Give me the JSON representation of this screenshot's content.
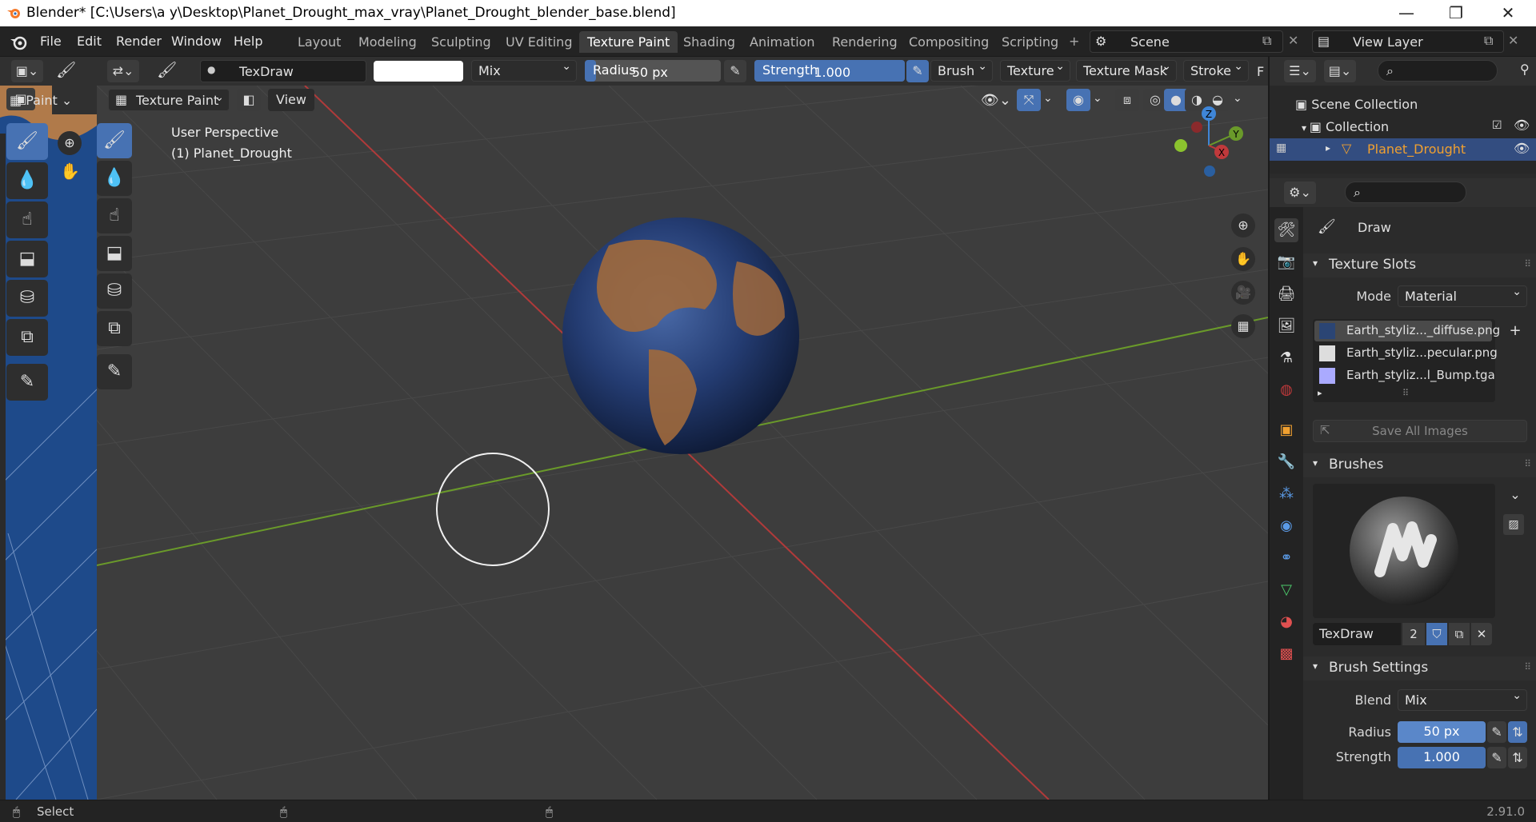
{
  "window": {
    "title": "Blender* [C:\\Users\\a y\\Desktop\\Planet_Drought_max_vray\\Planet_Drought_blender_base.blend]",
    "minimize": "—",
    "maximize": "❐",
    "close": "✕"
  },
  "menubar": {
    "items": [
      "File",
      "Edit",
      "Render",
      "Window",
      "Help"
    ]
  },
  "workspaces": {
    "tabs": [
      "Layout",
      "Modeling",
      "Sculpting",
      "UV Editing",
      "Texture Paint",
      "Shading",
      "Animation",
      "Rendering",
      "Compositing",
      "Scripting"
    ],
    "active": "Texture Paint",
    "add": "+"
  },
  "scene": {
    "name": "Scene",
    "view_layer": "View Layer"
  },
  "tool_header": {
    "mode": "Paint",
    "brush_name": "TexDraw",
    "blend": "Mix",
    "radius_label": "Radius",
    "radius_value": "50 px",
    "strength_label": "Strength",
    "strength_value": "1.000",
    "strength_fraction": 1.0,
    "menus": [
      "Brush",
      "Texture",
      "Texture Mask",
      "Stroke",
      "F"
    ]
  },
  "viewport_header": {
    "mode": "Texture Paint",
    "view": "View"
  },
  "viewport": {
    "perspective": "User Perspective",
    "object": "(1) Planet_Drought",
    "gizmo": {
      "x": "X",
      "y": "Y",
      "z": "Z"
    }
  },
  "outliner": {
    "scene_collection": "Scene Collection",
    "collection": "Collection",
    "object": "Planet_Drought"
  },
  "properties": {
    "tool_name": "Draw",
    "texture_slots": {
      "title": "Texture Slots",
      "mode_label": "Mode",
      "mode_value": "Material",
      "slots": [
        "Earth_styliz..._diffuse.png",
        "Earth_styliz...pecular.png",
        "Earth_styliz...l_Bump.tga"
      ],
      "save_all": "Save All Images"
    },
    "brushes": {
      "title": "Brushes",
      "brush_name": "TexDraw",
      "users": "2"
    },
    "brush_settings": {
      "title": "Brush Settings",
      "blend_label": "Blend",
      "blend_value": "Mix",
      "radius_label": "Radius",
      "radius_value": "50 px",
      "strength_label": "Strength",
      "strength_value": "1.000"
    }
  },
  "statusbar": {
    "select": "Select",
    "version": "2.91.0"
  },
  "colors": {
    "accent": "#4772b3",
    "object_orange": "#f0a030",
    "axis_x": "#c0393b",
    "axis_y": "#6a9a2a"
  }
}
